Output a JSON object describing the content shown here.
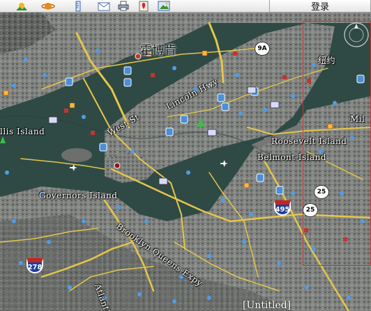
{
  "toolbar": {
    "login_label": "登录",
    "icons": [
      "sun-landscape-icon",
      "planet-icon",
      "ruler-icon",
      "email-icon",
      "print-icon",
      "placemark-icon",
      "image-overlay-icon"
    ]
  },
  "map": {
    "labels": {
      "hoboken": "霍博肯",
      "new_york": "纽约",
      "ellis_island": "llis Island",
      "west_st": "West St",
      "lincoln_hwy": "Lincoln Hwy",
      "governors_island": "Governors Island",
      "brooklyn_queens_expy": "Brooklyn Queens Expy",
      "roosevelt_island": "Roosevelt Island",
      "belmont_island": "Belmont Island",
      "mill": "Mil",
      "atlantic": "Atlanti"
    },
    "shields": {
      "route_9a": "9A",
      "route_25a": "25",
      "route_25b": "25",
      "i495": "495",
      "i278": "278"
    },
    "status_text": "[Untitled]"
  },
  "colors": {
    "water": "#2f4a45",
    "land": "#6b6e6c",
    "road": "#e6c64a",
    "selection": "#c63030"
  }
}
